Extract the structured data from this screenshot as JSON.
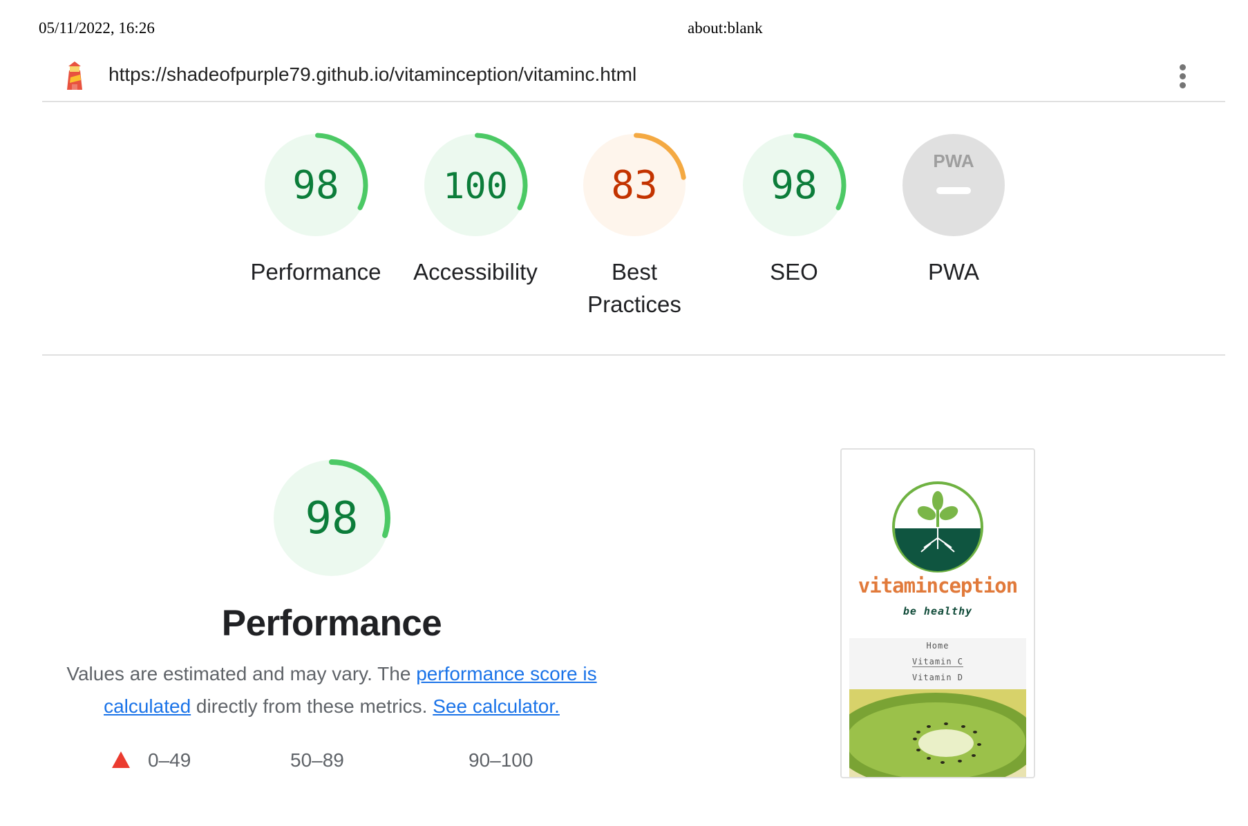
{
  "print_header": {
    "date": "05/11/2022, 16:26",
    "title": "about:blank"
  },
  "topbar": {
    "url": "https://shadeofpurple79.github.io/vitaminception/vitaminc.html",
    "logo_icon": "lighthouse-icon",
    "menu_icon": "kebab-menu-icon"
  },
  "gauges": [
    {
      "key": "performance",
      "score": "98",
      "value": 98,
      "label_lines": [
        "Performance"
      ],
      "rating": "pass"
    },
    {
      "key": "accessibility",
      "score": "100",
      "value": 100,
      "label_lines": [
        "Accessibility"
      ],
      "rating": "pass"
    },
    {
      "key": "best-practices",
      "score": "83",
      "value": 83,
      "label_lines": [
        "Best",
        "Practices"
      ],
      "rating": "average"
    },
    {
      "key": "seo",
      "score": "98",
      "value": 98,
      "label_lines": [
        "SEO"
      ],
      "rating": "pass"
    },
    {
      "key": "pwa",
      "score": "",
      "value": null,
      "label_lines": [
        "PWA"
      ],
      "rating": "na",
      "badge_text": "PWA"
    }
  ],
  "colors": {
    "pass_text": "#0c7d3a",
    "pass_arc": "#4cc965",
    "pass_bg": "#ecf9ef",
    "average_text": "#c33300",
    "average_arc": "#f4a942",
    "average_bg": "#fef5ec",
    "na_bg": "#e0e0e0",
    "fail": "#eb3b2f",
    "link": "#1a73e8"
  },
  "performance": {
    "score": "98",
    "value": 98,
    "title": "Performance",
    "desc_part1": "Values are estimated and may vary. The ",
    "link_score": "performance score is calculated",
    "desc_part2": " directly from these metrics. ",
    "link_calc": "See calculator."
  },
  "legend": {
    "fail_range": "0–49",
    "average_range": "50–89",
    "pass_range": "90–100"
  },
  "screenshot": {
    "brand_name": "vitaminception",
    "tagline": "be healthy",
    "nav": [
      "Home",
      "Vitamin C",
      "Vitamin D"
    ]
  }
}
